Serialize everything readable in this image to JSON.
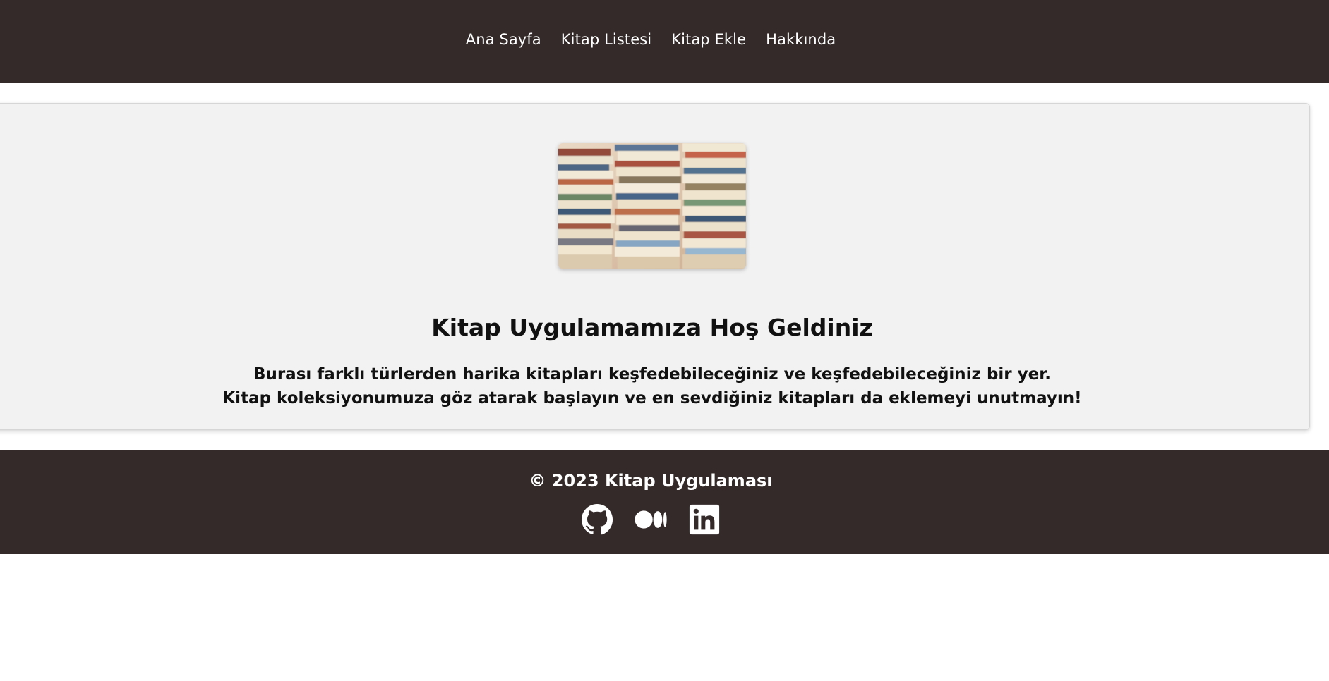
{
  "header": {
    "nav": [
      {
        "label": "Ana Sayfa"
      },
      {
        "label": "Kitap Listesi"
      },
      {
        "label": "Kitap Ekle"
      },
      {
        "label": "Hakkında"
      }
    ]
  },
  "hero": {
    "image_icon": "stacked-books-photo",
    "title": "Kitap Uygulamamıza Hoş Geldiniz",
    "text_line1": "Burası farklı türlerden harika kitapları keşfedebileceğiniz ve keşfedebileceğiniz bir yer.",
    "text_line2": "Kitap koleksiyonumuza göz atarak başlayın ve en sevdiğiniz kitapları da eklemeyi unutmayın!"
  },
  "footer": {
    "copyright": "© 2023 Kitap Uygulaması",
    "social": [
      {
        "icon": "github-icon"
      },
      {
        "icon": "medium-icon"
      },
      {
        "icon": "linkedin-icon"
      }
    ]
  },
  "colors": {
    "header_bg": "#332a29",
    "card_bg": "#f2f2f2",
    "text": "#111111"
  }
}
